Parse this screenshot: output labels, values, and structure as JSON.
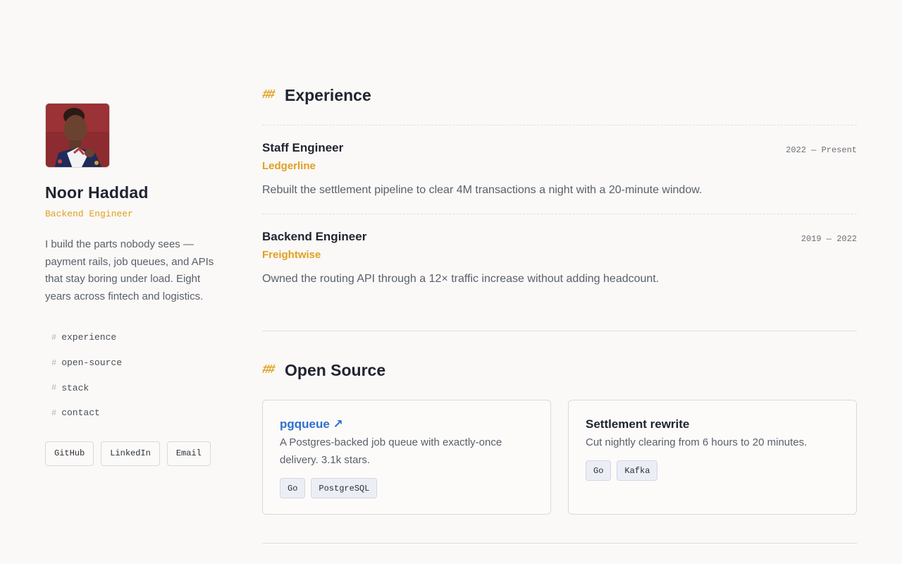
{
  "profile": {
    "name": "Noor Haddad",
    "role": "Backend Engineer",
    "bio": "I build the parts nobody sees — payment rails, job queues, and APIs that stay boring under load. Eight years across fintech and logistics."
  },
  "nav": {
    "hash": "#",
    "items": [
      "experience",
      "open-source",
      "stack",
      "contact"
    ]
  },
  "links": [
    "GitHub",
    "LinkedIn",
    "Email"
  ],
  "sections": {
    "mark": "##",
    "experience_title": "Experience",
    "open_source_title": "Open Source"
  },
  "experience": [
    {
      "title": "Staff Engineer",
      "company": "Ledgerline",
      "dates": "2022 — Present",
      "description": "Rebuilt the settlement pipeline to clear 4M transactions a night with a 20-minute window."
    },
    {
      "title": "Backend Engineer",
      "company": "Freightwise",
      "dates": "2019 — 2022",
      "description": "Owned the routing API through a 12× traffic increase without adding headcount."
    }
  ],
  "projects": [
    {
      "title": "pgqueue ↗",
      "description": "A Postgres-backed job queue with exactly-once delivery. 3.1k stars.",
      "tags": [
        "Go",
        "PostgreSQL"
      ]
    },
    {
      "title": "Settlement rewrite",
      "description": "Cut nightly clearing from 6 hours to 20 minutes.",
      "tags": [
        "Go",
        "Kafka"
      ]
    }
  ],
  "colors": {
    "accent": "#e0a020",
    "link": "#2f6fd0",
    "background": "#faf9f7"
  }
}
